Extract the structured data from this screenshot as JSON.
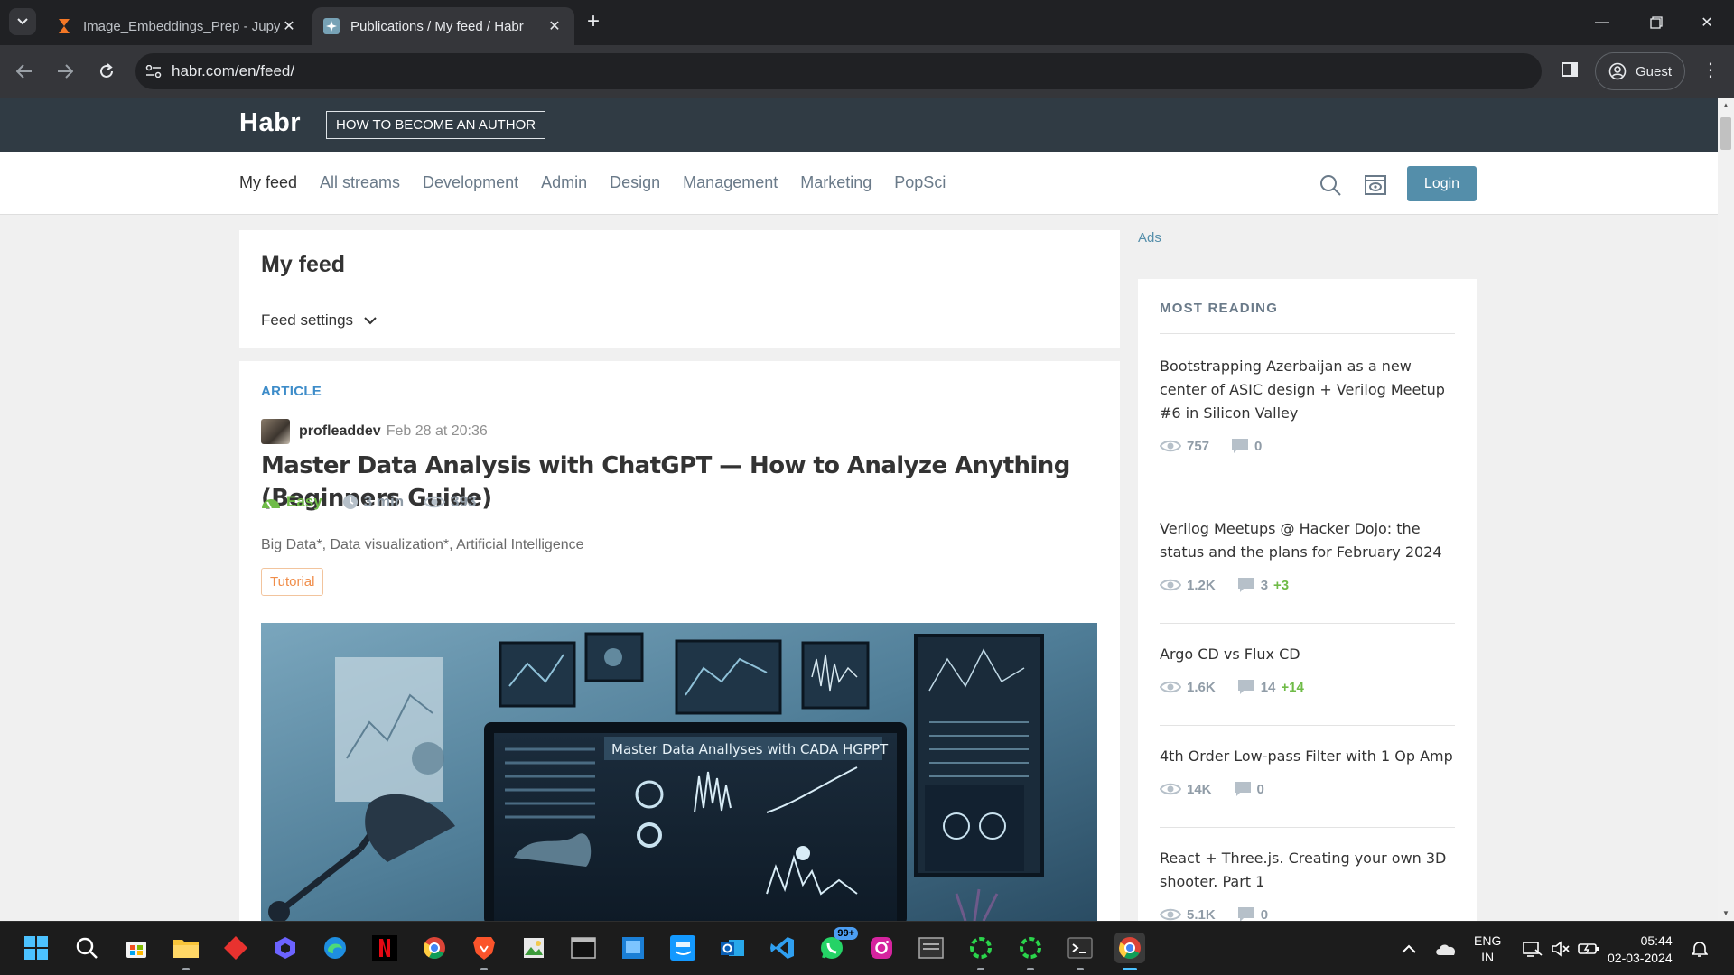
{
  "browser": {
    "tabs": [
      {
        "title": "Image_Embeddings_Prep - Jupy",
        "active": false
      },
      {
        "title": "Publications / My feed / Habr",
        "active": true
      }
    ],
    "url": "habr.com/en/feed/",
    "profile_label": "Guest"
  },
  "header": {
    "logo": "Habr",
    "become_author": "HOW TO BECOME AN AUTHOR"
  },
  "nav": {
    "items": [
      "My feed",
      "All streams",
      "Development",
      "Admin",
      "Design",
      "Management",
      "Marketing",
      "PopSci"
    ],
    "login": "Login"
  },
  "feed": {
    "title": "My feed",
    "settings_label": "Feed settings"
  },
  "article": {
    "type": "ARTICLE",
    "author": "profleaddev",
    "date": "Feb 28 at 20:36",
    "title": "Master Data Analysis with ChatGPT — How to Analyze Anything (Beginners Guide)",
    "difficulty": "Easy",
    "read_time": "3 min",
    "views": "393",
    "hubs": "Big Data*, Data visualization*, Artificial Intelligence",
    "tag": "Tutorial",
    "image_caption": "Master Data Anallyses with  CADA HGPPT"
  },
  "sidebar": {
    "ads_label": "Ads",
    "title": "MOST READING",
    "items": [
      {
        "title": "Bootstrapping Azerbaijan as a new center of ASIC design + Verilog Meetup #6 in Silicon Valley",
        "views": "757",
        "comments": "0",
        "new_comments": ""
      },
      {
        "title": "Verilog Meetups @ Hacker Dojo: the status and the plans for February 2024",
        "views": "1.2K",
        "comments": "3",
        "new_comments": "+3"
      },
      {
        "title": "Argo CD vs Flux CD",
        "views": "1.6K",
        "comments": "14",
        "new_comments": "+14"
      },
      {
        "title": "4th Order Low-pass Filter with 1 Op Amp",
        "views": "14K",
        "comments": "0",
        "new_comments": ""
      },
      {
        "title": "React + Three.js. Creating your own 3D shooter. Part 1",
        "views": "5.1K",
        "comments": "0",
        "new_comments": ""
      }
    ]
  },
  "taskbar": {
    "whatsapp_badge": "99+",
    "lang_line1": "ENG",
    "lang_line2": "IN",
    "time": "05:44",
    "date": "02-03-2024"
  },
  "colors": {
    "habr_header": "#303b44",
    "login_button": "#548eaa",
    "link_blue": "#3d8cc9",
    "easy_green": "#6fbb47",
    "tag_orange": "#f08d49"
  }
}
